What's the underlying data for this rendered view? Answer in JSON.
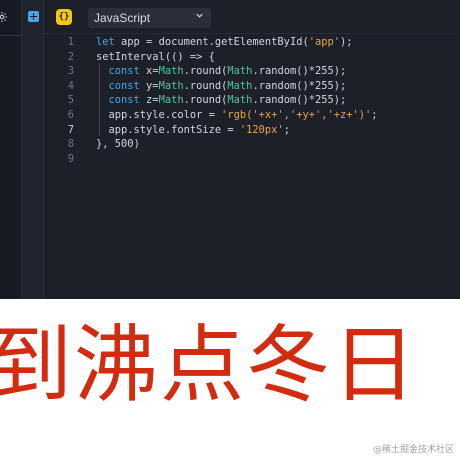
{
  "toolbar": {
    "lang_icon": "{}",
    "language": "JavaScript",
    "icons": {
      "settings": "gear-icon",
      "add": "plus-icon",
      "dropdown": "chevron-down-icon"
    }
  },
  "colors": {
    "editor_bg": "#1d2029",
    "keyword": "#46a7e6",
    "math": "#4fc3a1",
    "string": "#e6a34f",
    "caption_text": "#d32b0f"
  },
  "editor": {
    "active_line": 7,
    "lines": [
      {
        "n": "1",
        "tokens": [
          [
            "kw",
            "let"
          ],
          [
            "id",
            " app = document.getElementById("
          ],
          [
            "str",
            "'app'"
          ],
          [
            "id",
            ");"
          ]
        ]
      },
      {
        "n": "2",
        "tokens": [
          [
            "id",
            "setInterval(() => {"
          ]
        ]
      },
      {
        "n": "3",
        "tokens": [
          [
            "id",
            "  "
          ],
          [
            "kw",
            "const"
          ],
          [
            "id",
            " x="
          ],
          [
            "math",
            "Math"
          ],
          [
            "id",
            ".round("
          ],
          [
            "math",
            "Math"
          ],
          [
            "id",
            ".random()*255);"
          ]
        ]
      },
      {
        "n": "4",
        "tokens": [
          [
            "id",
            "  "
          ],
          [
            "kw",
            "const"
          ],
          [
            "id",
            " y="
          ],
          [
            "math",
            "Math"
          ],
          [
            "id",
            ".round("
          ],
          [
            "math",
            "Math"
          ],
          [
            "id",
            ".random()*255);"
          ]
        ]
      },
      {
        "n": "5",
        "tokens": [
          [
            "id",
            "  "
          ],
          [
            "kw",
            "const"
          ],
          [
            "id",
            " z="
          ],
          [
            "math",
            "Math"
          ],
          [
            "id",
            ".round("
          ],
          [
            "math",
            "Math"
          ],
          [
            "id",
            ".random()*255);"
          ]
        ]
      },
      {
        "n": "6",
        "tokens": [
          [
            "id",
            "  app.style.color = "
          ],
          [
            "str",
            "'rgb('+x+','+y+','+z+')'"
          ],
          [
            "id",
            ";"
          ]
        ]
      },
      {
        "n": "7",
        "tokens": [
          [
            "id",
            "  app.style.fontSize = "
          ],
          [
            "str",
            "'120px'"
          ],
          [
            "id",
            ";"
          ]
        ]
      },
      {
        "n": "8",
        "tokens": [
          [
            "id",
            "}, "
          ],
          [
            "num",
            "500"
          ],
          [
            "id",
            ")"
          ]
        ]
      },
      {
        "n": "9",
        "tokens": []
      }
    ]
  },
  "caption": {
    "text": "到沸点冬日",
    "watermark": "@稀土掘金技术社区"
  }
}
